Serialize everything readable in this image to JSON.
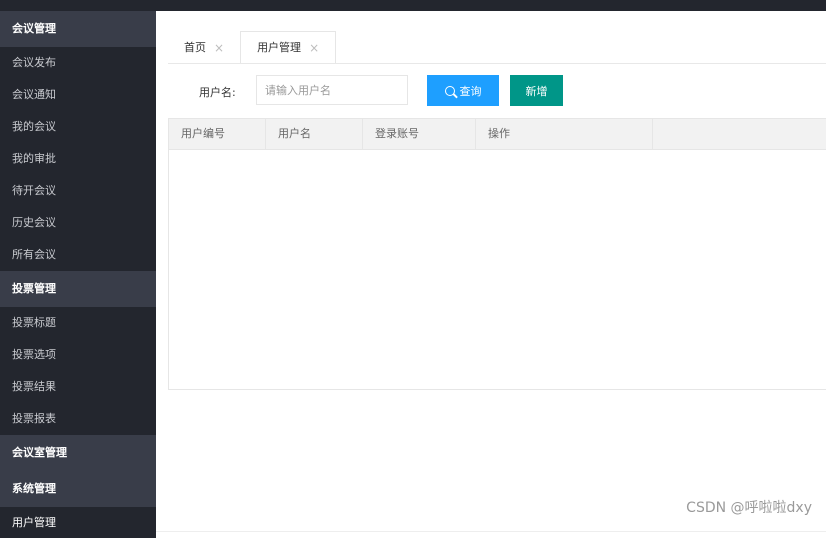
{
  "sidebar": {
    "groups": [
      {
        "title": "会议管理",
        "items": [
          "会议发布",
          "会议通知",
          "我的会议",
          "我的审批",
          "待开会议",
          "历史会议",
          "所有会议"
        ]
      },
      {
        "title": "投票管理",
        "items": [
          "投票标题",
          "投票选项",
          "投票结果",
          "投票报表"
        ]
      },
      {
        "title": "会议室管理",
        "items": []
      },
      {
        "title": "系统管理",
        "items": [
          "用户管理"
        ]
      }
    ]
  },
  "tabs": [
    {
      "label": "首页",
      "close": "×"
    },
    {
      "label": "用户管理",
      "close": "×"
    }
  ],
  "search": {
    "label": "用户名:",
    "placeholder": "请输入用户名",
    "query_label": "查询",
    "add_label": "新增"
  },
  "table": {
    "columns": [
      "用户编号",
      "用户名",
      "登录账号",
      "操作",
      ""
    ]
  },
  "watermark": "CSDN @呼啦啦dxy",
  "colors": {
    "sidebar_bg": "#23262e",
    "sidebar_group_bg": "#393d49",
    "query_button": "#1e9fff",
    "add_button": "#009688"
  }
}
